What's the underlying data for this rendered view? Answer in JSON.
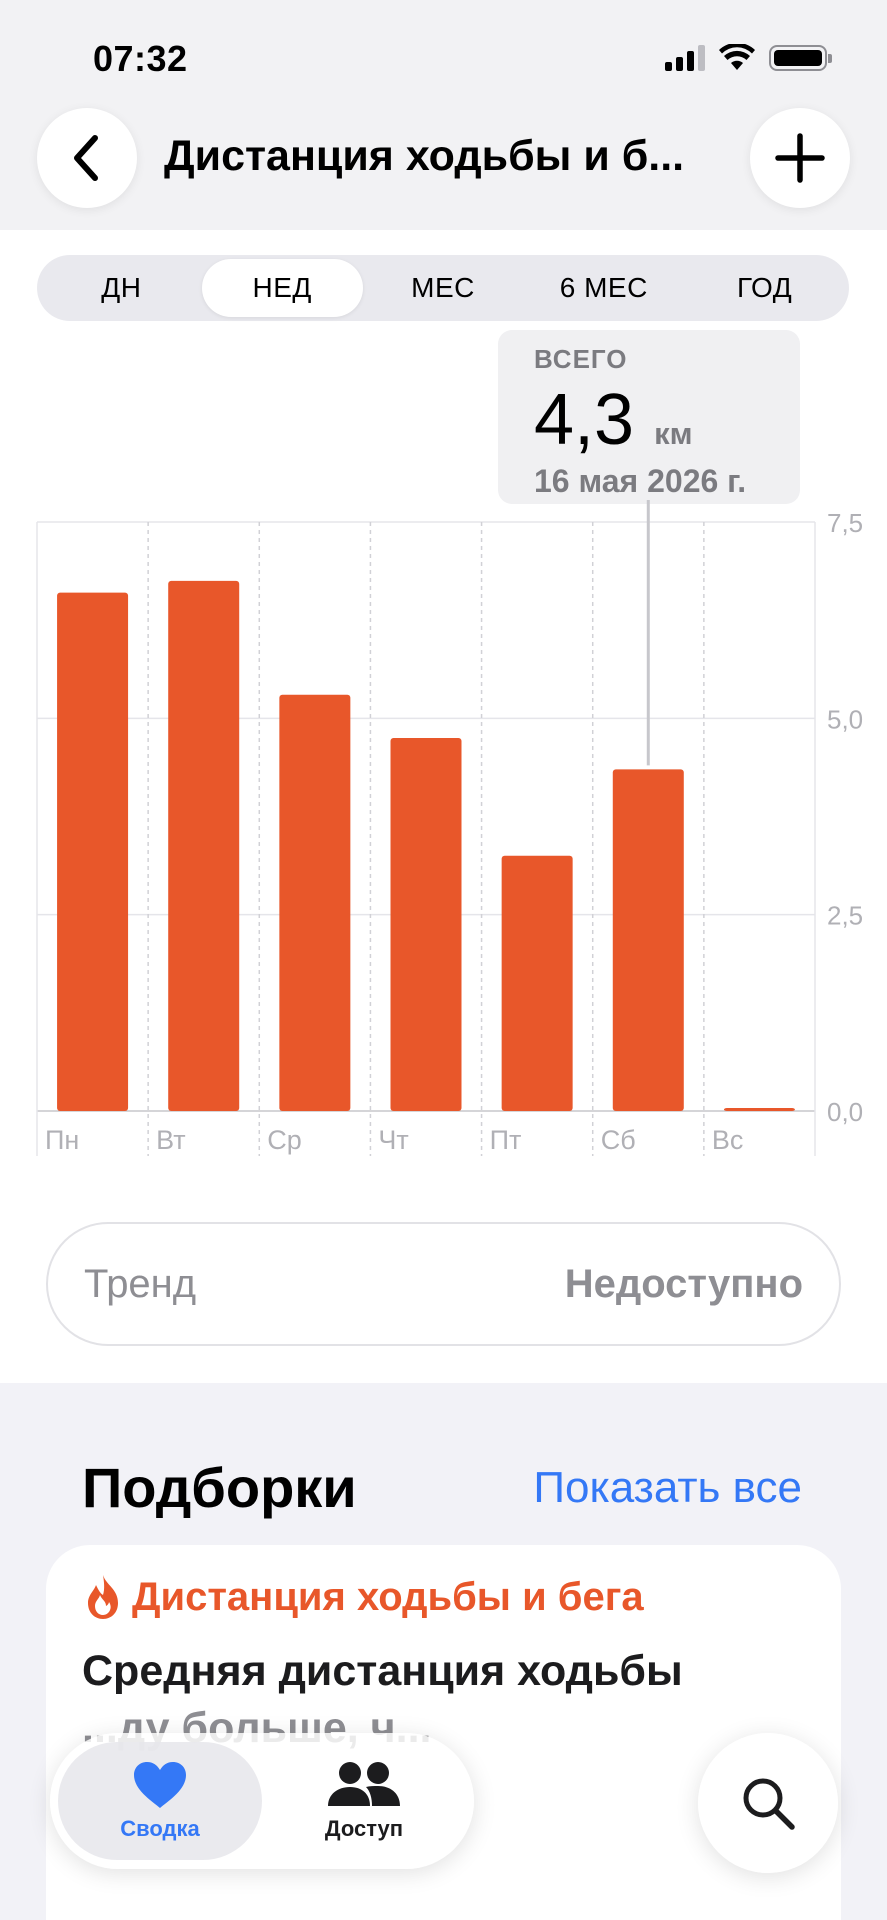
{
  "status_bar": {
    "time": "07:32"
  },
  "nav": {
    "title": "Дистанция ходьбы и б..."
  },
  "periods": [
    {
      "label": "ДН",
      "active": false
    },
    {
      "label": "НЕД",
      "active": true
    },
    {
      "label": "МЕС",
      "active": false
    },
    {
      "label": "6 МЕС",
      "active": false
    },
    {
      "label": "ГОД",
      "active": false
    }
  ],
  "selection": {
    "label": "ВСЕГО",
    "value": "4,3",
    "unit": "км",
    "date": "16 мая 2026 г."
  },
  "chart_data": {
    "type": "bar",
    "categories": [
      "Пн",
      "Вт",
      "Ср",
      "Чт",
      "Пт",
      "Сб",
      "Вс"
    ],
    "values": [
      6.6,
      6.75,
      5.3,
      4.75,
      3.25,
      4.35,
      0.02
    ],
    "selected_index": 5,
    "ylim": [
      0,
      7.5
    ],
    "yticks": [
      "0,0",
      "2,5",
      "5,0",
      "7,5"
    ],
    "ytick_values": [
      0,
      2.5,
      5.0,
      7.5
    ],
    "bar_color": "#e8572a",
    "grid": true
  },
  "trend": {
    "label": "Тренд",
    "value": "Недоступно"
  },
  "highlights": {
    "title": "Подборки",
    "show_all": "Показать все",
    "card": {
      "category": "Дистанция ходьбы и бега",
      "line1": "Средняя дистанция ходьбы",
      "line2": "...ду больше, ч..."
    }
  },
  "tabbar": {
    "summary": "Сводка",
    "sharing": "Доступ"
  },
  "colors": {
    "accent_blue": "#3478f6",
    "activity_orange": "#e8572a"
  }
}
